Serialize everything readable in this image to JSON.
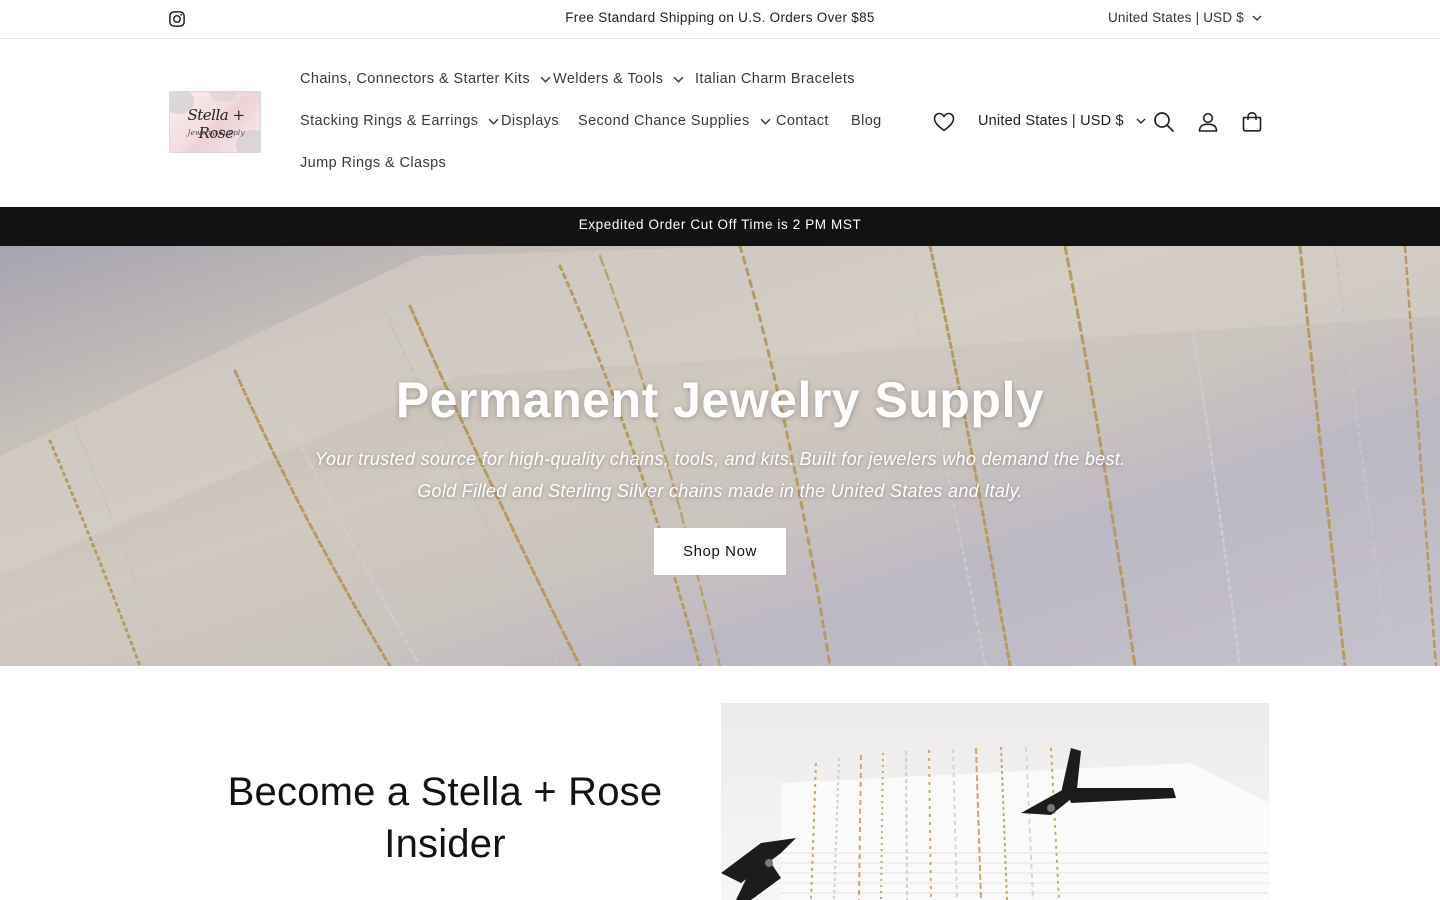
{
  "announcement": {
    "text": "Free Standard Shipping on U.S. Orders Over $85",
    "locale": "United States | USD $",
    "social_icon": "instagram-icon"
  },
  "header": {
    "logo": {
      "script": "Stella + Rose",
      "subtitle": "Jewelry Supply"
    },
    "nav": [
      {
        "label": "Chains, Connectors & Starter Kits",
        "has_dropdown": true
      },
      {
        "label": "Welders & Tools",
        "has_dropdown": true
      },
      {
        "label": "Italian Charm Bracelets",
        "has_dropdown": false
      },
      {
        "label": "Stacking Rings & Earrings",
        "has_dropdown": true
      },
      {
        "label": "Displays",
        "has_dropdown": false
      },
      {
        "label": "Second Chance Supplies",
        "has_dropdown": true
      },
      {
        "label": "Contact",
        "has_dropdown": false
      },
      {
        "label": "Blog",
        "has_dropdown": false
      },
      {
        "label": "Jump Rings & Clasps",
        "has_dropdown": false
      }
    ],
    "locale": "United States | USD $",
    "icons": [
      "heart-icon",
      "search-icon",
      "account-icon",
      "cart-icon"
    ]
  },
  "notice": {
    "text": "Expedited Order Cut Off Time is 2 PM MST"
  },
  "hero": {
    "title": "Permanent Jewelry Supply",
    "subtitle_line1": "Your trusted source for high-quality chains, tools, and kits. Built for jewelers who demand the best.",
    "subtitle_line2": "Gold Filled and Sterling Silver chains made in the United States and Italy.",
    "button_label": "Shop Now"
  },
  "insider": {
    "title_line1": "Become a Stella + Rose",
    "title_line2": "Insider"
  },
  "colors": {
    "notice_bg": "#121212",
    "text": "#121212",
    "gold_chain": "#c9a96a",
    "silver_chain": "#d8d8d8"
  }
}
